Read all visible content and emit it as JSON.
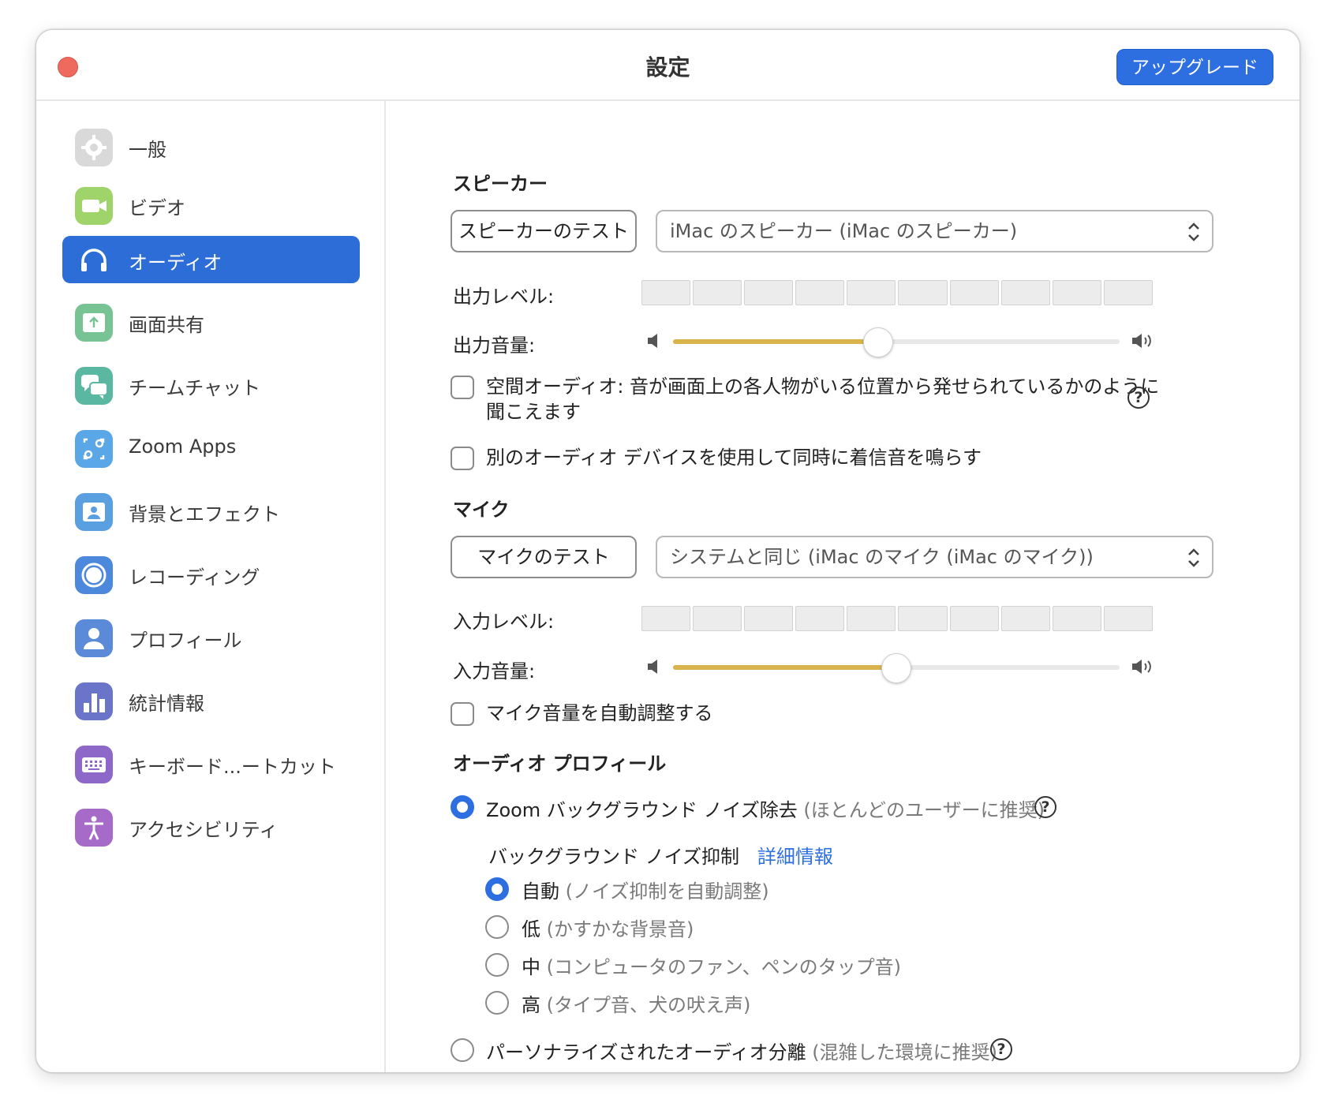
{
  "window": {
    "title": "設定",
    "upgrade_label": "アップグレード"
  },
  "sidebar": {
    "items": [
      {
        "label": "一般",
        "icon": "gear-icon",
        "color": "#d9d9d9"
      },
      {
        "label": "ビデオ",
        "icon": "video-camera-icon",
        "color": "#9ed46a"
      },
      {
        "label": "オーディオ",
        "icon": "headphones-icon",
        "color": "#2d6dd8",
        "active": true
      },
      {
        "label": "画面共有",
        "icon": "screen-share-icon",
        "color": "#77c394"
      },
      {
        "label": "チームチャット",
        "icon": "chat-bubbles-icon",
        "color": "#5ab7a2"
      },
      {
        "label": "Zoom Apps",
        "icon": "apps-icon",
        "color": "#5aa7e8"
      },
      {
        "label": "背景とエフェクト",
        "icon": "background-person-icon",
        "color": "#5a9fe0"
      },
      {
        "label": "レコーディング",
        "icon": "record-icon",
        "color": "#4c88db"
      },
      {
        "label": "プロフィール",
        "icon": "profile-icon",
        "color": "#5b8ad8"
      },
      {
        "label": "統計情報",
        "icon": "bar-chart-icon",
        "color": "#6a74c9"
      },
      {
        "label": "キーボード...ートカット",
        "icon": "keyboard-icon",
        "color": "#8d68c8"
      },
      {
        "label": "アクセシビリティ",
        "icon": "accessibility-icon",
        "color": "#a66ac9"
      }
    ]
  },
  "speaker": {
    "section_title": "スピーカー",
    "test_label": "スピーカーのテスト",
    "device": "iMac のスピーカー (iMac のスピーカー)",
    "output_level_label": "出力レベル:",
    "output_volume_label": "出力音量:",
    "output_volume_value": 0.46,
    "spatial_audio_label_line1": "空間オーディオ: 音が画面上の各人物がいる位置から発せられているかのように",
    "spatial_audio_label_line2": "聞こえます",
    "separate_device_label": "別のオーディオ デバイスを使用して同時に着信音を鳴らす"
  },
  "mic": {
    "section_title": "マイク",
    "test_label": "マイクのテスト",
    "device": "システムと同じ (iMac のマイク (iMac のマイク))",
    "input_level_label": "入力レベル:",
    "input_volume_label": "入力音量:",
    "input_volume_value": 0.5,
    "auto_adjust_label": "マイク音量を自動調整する"
  },
  "audio_profile": {
    "section_title": "オーディオ プロフィール",
    "zoom_noise_label": "Zoom バックグラウンド ノイズ除去",
    "zoom_noise_hint": "(ほとんどのユーザーに推奨)",
    "suppression_label": "バックグラウンド ノイズ抑制",
    "learn_more_label": "詳細情報",
    "options": [
      {
        "label": "自動",
        "hint": "(ノイズ抑制を自動調整)",
        "selected": true
      },
      {
        "label": "低",
        "hint": "(かすかな背景音)",
        "selected": false
      },
      {
        "label": "中",
        "hint": "(コンピュータのファン、ペンのタップ音)",
        "selected": false
      },
      {
        "label": "高",
        "hint": "(タイプ音、犬の吠え声)",
        "selected": false
      }
    ],
    "personalized_label": "パーソナライズされたオーディオ分離",
    "personalized_hint": "(混雑した環境に推奨)"
  }
}
